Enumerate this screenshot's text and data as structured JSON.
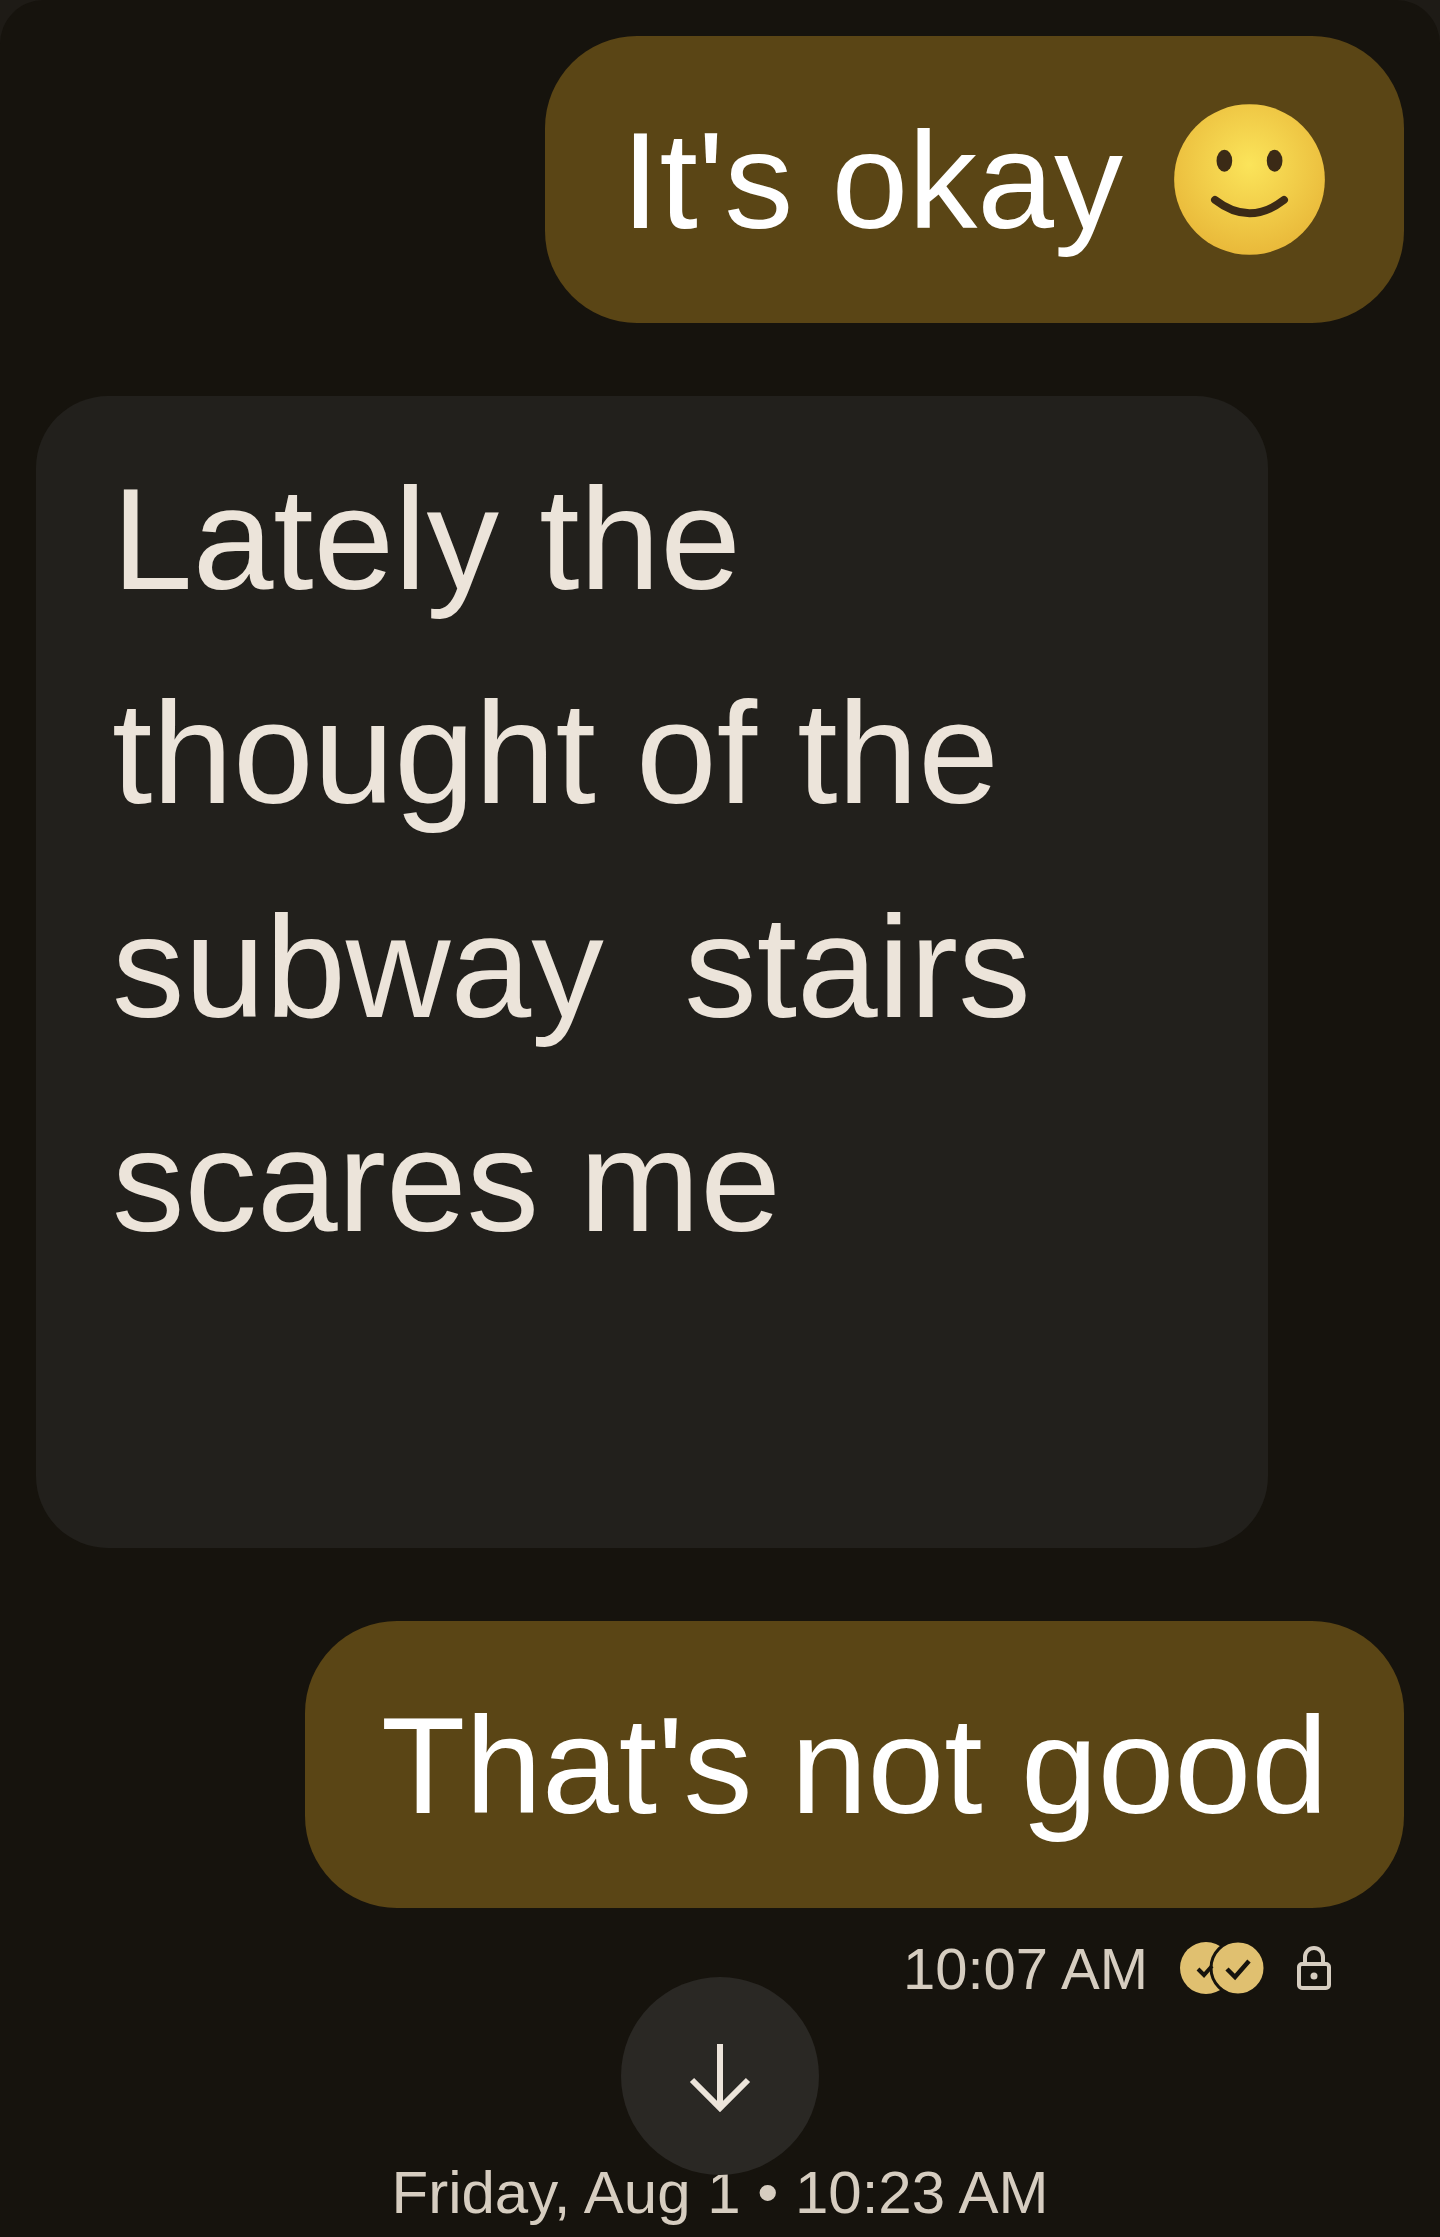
{
  "messages": [
    {
      "kind": "sent",
      "text": "It's okay",
      "has_emoji": true
    },
    {
      "kind": "received",
      "text": "Lately the thought of the subway  stairs scares me",
      "has_emoji": false
    },
    {
      "kind": "sent",
      "text": "That's not good",
      "has_emoji": false
    }
  ],
  "status": {
    "time": "10:07 AM",
    "read": true,
    "encrypted": true
  },
  "scroll_button": {
    "visible": true
  },
  "date_divider": "Friday, Aug 1 • 10:23 AM"
}
